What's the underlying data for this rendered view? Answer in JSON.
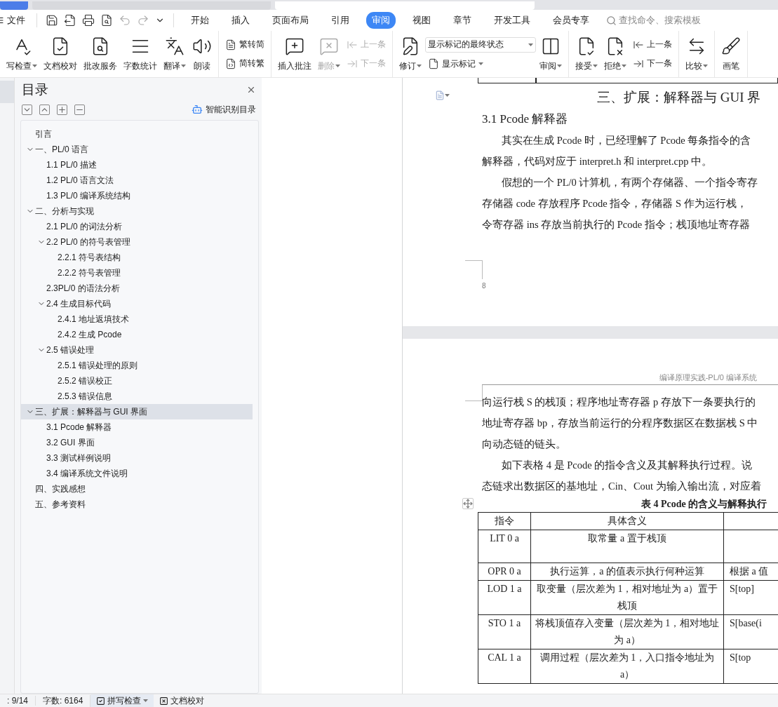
{
  "menu": {
    "file": "文件"
  },
  "ribbon_tabs": [
    {
      "label": "开始",
      "selected": false
    },
    {
      "label": "插入",
      "selected": false
    },
    {
      "label": "页面布局",
      "selected": false
    },
    {
      "label": "引用",
      "selected": false
    },
    {
      "label": "审阅",
      "selected": true
    },
    {
      "label": "视图",
      "selected": false
    },
    {
      "label": "章节",
      "selected": false
    },
    {
      "label": "开发工具",
      "selected": false
    },
    {
      "label": "会员专享",
      "selected": false
    }
  ],
  "search": {
    "placeholder": "查找命令、搜索模板"
  },
  "ribbon_groups": [
    {
      "items": [
        {
          "kind": "big",
          "label": "写检查",
          "caret": true,
          "disabled": false
        },
        {
          "kind": "big",
          "label": "文档校对",
          "caret": false,
          "disabled": false
        },
        {
          "kind": "big",
          "label": "批改服务",
          "caret": false,
          "disabled": false
        },
        {
          "kind": "big",
          "label": "字数统计",
          "caret": false,
          "disabled": false
        },
        {
          "kind": "big",
          "label": "翻译",
          "caret": true,
          "disabled": false
        },
        {
          "kind": "big",
          "label": "朗读",
          "caret": false,
          "disabled": false
        }
      ]
    },
    {
      "items": [
        {
          "kind": "small",
          "label": "繁转简",
          "caret": false,
          "disabled": false
        },
        {
          "kind": "small",
          "label": "简转繁",
          "caret": false,
          "disabled": false
        }
      ]
    },
    {
      "items": [
        {
          "kind": "big",
          "label": "插入批注",
          "caret": false,
          "disabled": false
        },
        {
          "kind": "big",
          "label": "删除",
          "caret": true,
          "disabled": true
        },
        {
          "kind": "small",
          "label": "上一条",
          "caret": false,
          "disabled": true
        },
        {
          "kind": "small",
          "label": "下一条",
          "caret": false,
          "disabled": true
        }
      ]
    },
    {
      "items": [
        {
          "kind": "big",
          "label": "修订",
          "caret": true,
          "disabled": false
        },
        {
          "kind": "select",
          "value": "显示标记的最终状态"
        },
        {
          "kind": "small",
          "label": "显示标记",
          "caret": true,
          "disabled": false
        },
        {
          "kind": "big",
          "label": "审阅",
          "caret": true,
          "disabled": false
        }
      ]
    },
    {
      "items": [
        {
          "kind": "big",
          "label": "接受",
          "caret": true,
          "disabled": false
        },
        {
          "kind": "big",
          "label": "拒绝",
          "caret": true,
          "disabled": false
        },
        {
          "kind": "small",
          "label": "上一条",
          "caret": false,
          "disabled": false
        },
        {
          "kind": "small",
          "label": "下一条",
          "caret": false,
          "disabled": false
        }
      ]
    },
    {
      "items": [
        {
          "kind": "big",
          "label": "比较",
          "caret": true,
          "disabled": false
        }
      ]
    },
    {
      "items": [
        {
          "kind": "big",
          "label": "画笔",
          "caret": false,
          "disabled": false
        }
      ]
    }
  ],
  "nav_panel": {
    "title": "目录",
    "smart_toc": "智能识别目录",
    "tree": [
      {
        "label": "引言",
        "selected": false
      },
      {
        "label": "一、PL/0 语言",
        "expanded": true,
        "selected": false,
        "children": [
          {
            "label": "1.1 PL/0 描述",
            "selected": false
          },
          {
            "label": "1.2 PL/0 语言文法",
            "selected": false
          },
          {
            "label": "1.3 PL/0 编译系统结构",
            "selected": false
          }
        ]
      },
      {
        "label": "二、分析与实现",
        "expanded": true,
        "selected": false,
        "children": [
          {
            "label": "2.1 PL/0 的词法分析",
            "selected": false
          },
          {
            "label": "2.2 PL/0 的符号表管理",
            "expanded": true,
            "selected": false,
            "children": [
              {
                "label": "2.2.1 符号表结构",
                "selected": false
              },
              {
                "label": "2.2.2 符号表管理",
                "selected": false
              }
            ]
          },
          {
            "label": "2.3PL/0 的语法分析",
            "selected": false
          },
          {
            "label": "2.4  生成目标代码",
            "expanded": true,
            "selected": false,
            "children": [
              {
                "label": "2.4.1  地址返填技术",
                "selected": false
              },
              {
                "label": "2.4.2 生成 Pcode",
                "selected": false
              }
            ]
          },
          {
            "label": "2.5 错误处理",
            "expanded": true,
            "selected": false,
            "children": [
              {
                "label": "2.5.1 错误处理的原则",
                "selected": false
              },
              {
                "label": "2.5.2 错误校正",
                "selected": false
              },
              {
                "label": "2.5.3 错误信息",
                "selected": false
              }
            ]
          }
        ]
      },
      {
        "label": "三、扩展：解释器与 GUI 界面",
        "expanded": true,
        "selected": true,
        "children": [
          {
            "label": "3.1 Pcode 解释器",
            "selected": false
          },
          {
            "label": "3.2 GUI 界面",
            "selected": false
          },
          {
            "label": "3.3  测试样例说明",
            "selected": false
          },
          {
            "label": "3.4  编译系统文件说明",
            "selected": false
          }
        ]
      },
      {
        "label": "四、实践感想",
        "selected": false
      },
      {
        "label": "五、参考资料",
        "selected": false
      }
    ]
  },
  "page_1": {
    "chapter_heading": "三、扩展：解释器与 GUI 界",
    "section_heading": "3.1 Pcode 解释器",
    "paragraphs": [
      [
        "其实在生成 Pcode 时，已经理解了 Pcode 每条指令的含",
        "解释器，代码对应于 interpret.h 和 interpret.cpp 中。"
      ],
      [
        "假想的一个 PL/0 计算机，有两个存储器、一个指令寄存",
        "存储器 code 存放程序 Pcode 指令，存储器 S 作为运行栈，",
        "令寄存器 ins 存放当前执行的 Pcode 指令；栈顶地址寄存器"
      ]
    ],
    "page_number": "8"
  },
  "page_2": {
    "header": "编译原理实践-PL/0 编译系统",
    "continued_lines": [
      "向运行栈 S 的栈顶；程序地址寄存器 p 存放下一条要执行的",
      "地址寄存器 bp，存放当前运行的分程序数据区在数据栈 S 中",
      "向动态链的链头。"
    ],
    "paragraphs": [
      [
        "如下表格 4 是 Pcode 的指令含义及其解释执行过程。说",
        "态链求出数据区的基地址，Cin、Cout 为输入输出流，对应着"
      ]
    ],
    "table_caption": "表 4 Pcode 的含义与解释执行",
    "table": {
      "columns": [
        "指令",
        "具体含义"
      ],
      "rows": [
        [
          "LIT 0 a",
          "取常量 a 置于栈顶"
        ],
        [
          "OPR 0 a",
          "执行运算，a 的值表示执行何种运算",
          "根据 a 值"
        ],
        [
          "LOD 1 a",
          "取变量（层次差为 1，相对地址为 a）置于栈顶",
          "S[top]"
        ],
        [
          "STO 1 a",
          "将栈顶值存入变量（层次差为 1，相对地址为 a）",
          "S[base(i"
        ],
        [
          "CAL 1 a",
          "调用过程（层次差为 1，入口指令地址为 a）",
          "S[top"
        ]
      ]
    }
  },
  "status_bar": {
    "page": ": 9/14",
    "word_count": "字数: 6164",
    "spell_check": "拼写检查",
    "proofread": "文档校对"
  }
}
